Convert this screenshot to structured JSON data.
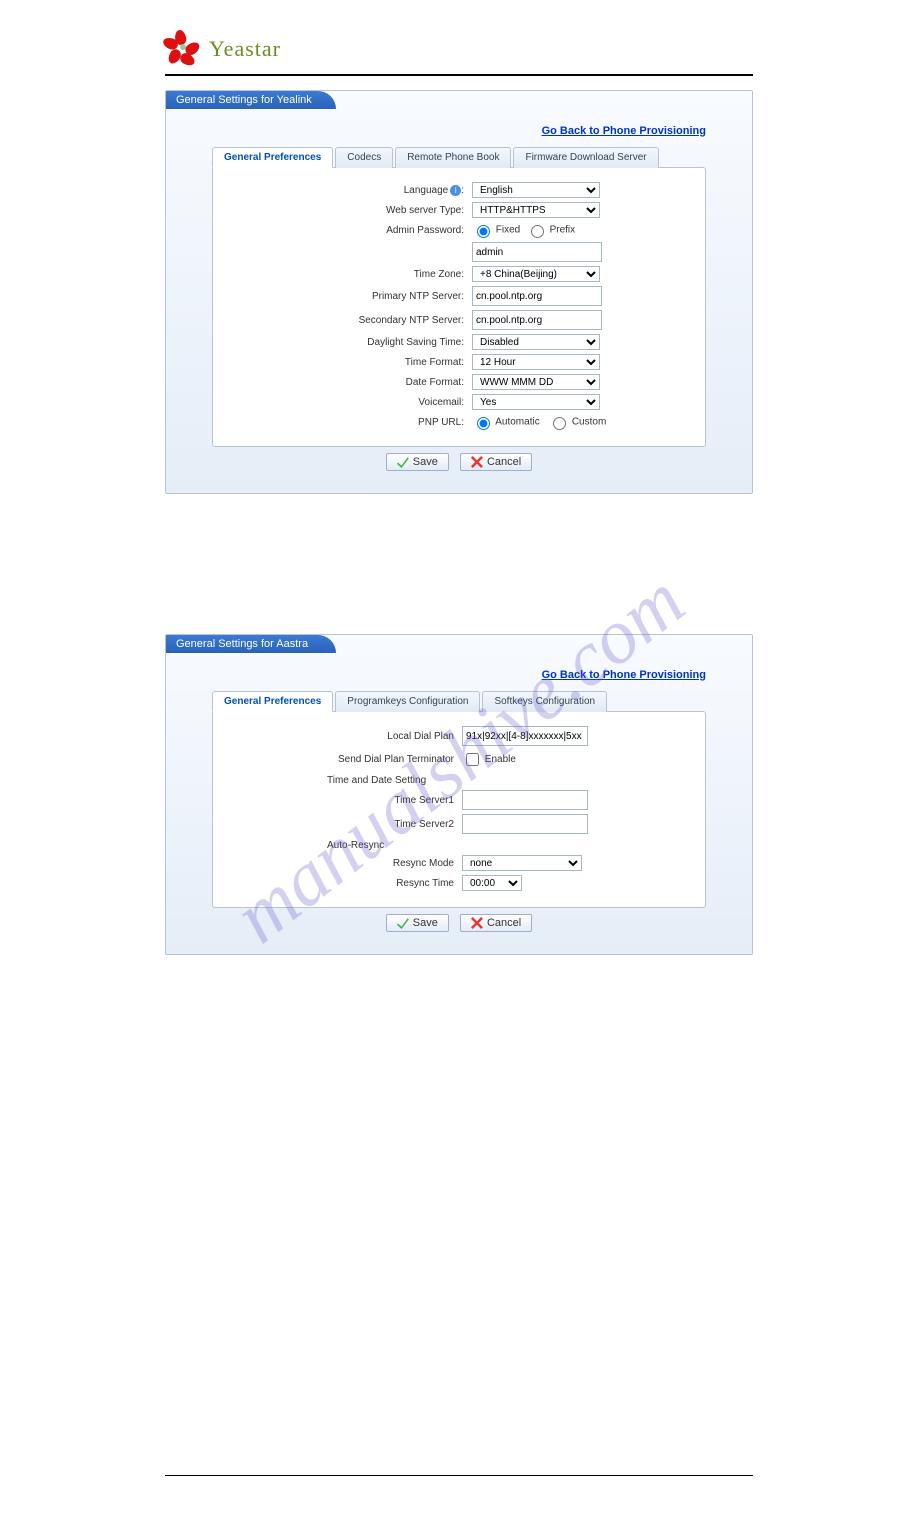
{
  "brand": "Yeastar",
  "watermark": "manualshive.com",
  "panel1": {
    "title": "General Settings for Yealink",
    "backlink": "Go Back to Phone Provisioning",
    "tabs": [
      "General Preferences",
      "Codecs",
      "Remote Phone Book",
      "Firmware Download Server"
    ],
    "fields": {
      "language_label": "Language",
      "language_value": "English",
      "webserver_label": "Web server Type:",
      "webserver_value": "HTTP&HTTPS",
      "adminpw_label": "Admin Password:",
      "adminpw_fixed": "Fixed",
      "adminpw_prefix": "Prefix",
      "adminpw_value": "admin",
      "timezone_label": "Time Zone:",
      "timezone_value": "+8 China(Beijing)",
      "ntp1_label": "Primary NTP Server:",
      "ntp1_value": "cn.pool.ntp.org",
      "ntp2_label": "Secondary NTP Server:",
      "ntp2_value": "cn.pool.ntp.org",
      "dst_label": "Daylight Saving Time:",
      "dst_value": "Disabled",
      "timefmt_label": "Time Format:",
      "timefmt_value": "12 Hour",
      "datefmt_label": "Date Format:",
      "datefmt_value": "WWW MMM DD",
      "voicemail_label": "Voicemail:",
      "voicemail_value": "Yes",
      "pnp_label": "PNP URL:",
      "pnp_auto": "Automatic",
      "pnp_custom": "Custom"
    }
  },
  "panel2": {
    "title": "General Settings for Aastra",
    "backlink": "Go Back to Phone Provisioning",
    "tabs": [
      "General Preferences",
      "Programkeys Configuration",
      "Softkeys Configuration"
    ],
    "fields": {
      "dialplan_label": "Local Dial Plan",
      "dialplan_value": "91x|92xx|[4-8]xxxxxxx|5xx",
      "terminator_label": "Send Dial Plan Terminator",
      "terminator_text": "Enable",
      "section_time": "Time and Date Setting",
      "ts1_label": "Time Server1",
      "ts1_value": "",
      "ts2_label": "Time Server2",
      "ts2_value": "",
      "section_resync": "Auto-Resync",
      "resyncmode_label": "Resync Mode",
      "resyncmode_value": "none",
      "resynctime_label": "Resync Time",
      "resynctime_value": "00:00"
    }
  },
  "buttons": {
    "save": "Save",
    "cancel": "Cancel"
  }
}
